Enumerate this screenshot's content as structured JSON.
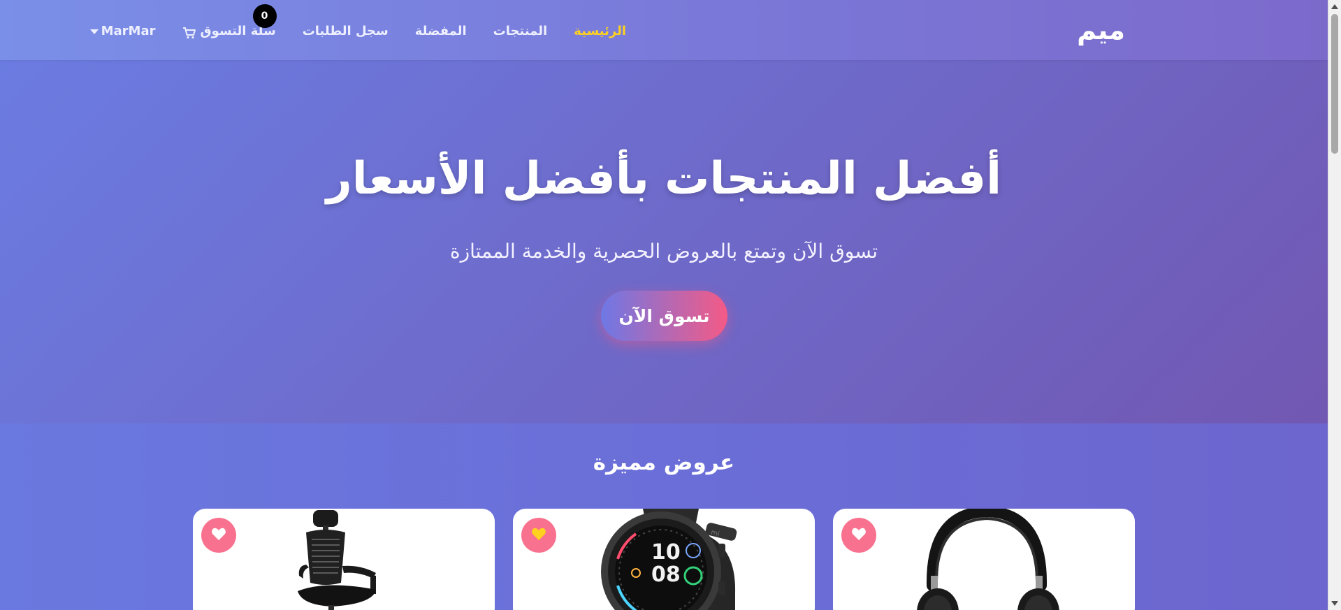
{
  "brand": "ميم",
  "nav": {
    "home": "الرئيسية",
    "products": "المنتجات",
    "favorites": "المفضلة",
    "orders": "سجل الطلبات",
    "cart": "سلة التسوق",
    "cart_count": "0",
    "user": "MarMar"
  },
  "hero": {
    "title": "أفضل المنتجات بأفضل الأسعار",
    "subtitle": "تسوق الآن وتمتع بالعروض الحصرية والخدمة الممتازة",
    "cta": "تسوق الآن"
  },
  "offers": {
    "title": "عروض مميزة",
    "products": [
      {
        "image": "headphones",
        "favorite": false
      },
      {
        "image": "smartwatch",
        "favorite": true,
        "watch_time": "10 08"
      },
      {
        "image": "office-chair",
        "favorite": false
      }
    ]
  },
  "colors": {
    "accent_active": "#ffd21f",
    "favorite_bg": "#f8728f",
    "favorite_active_heart": "#ffd21f",
    "cta_start": "#6e78e5",
    "cta_end": "#f45a86"
  }
}
